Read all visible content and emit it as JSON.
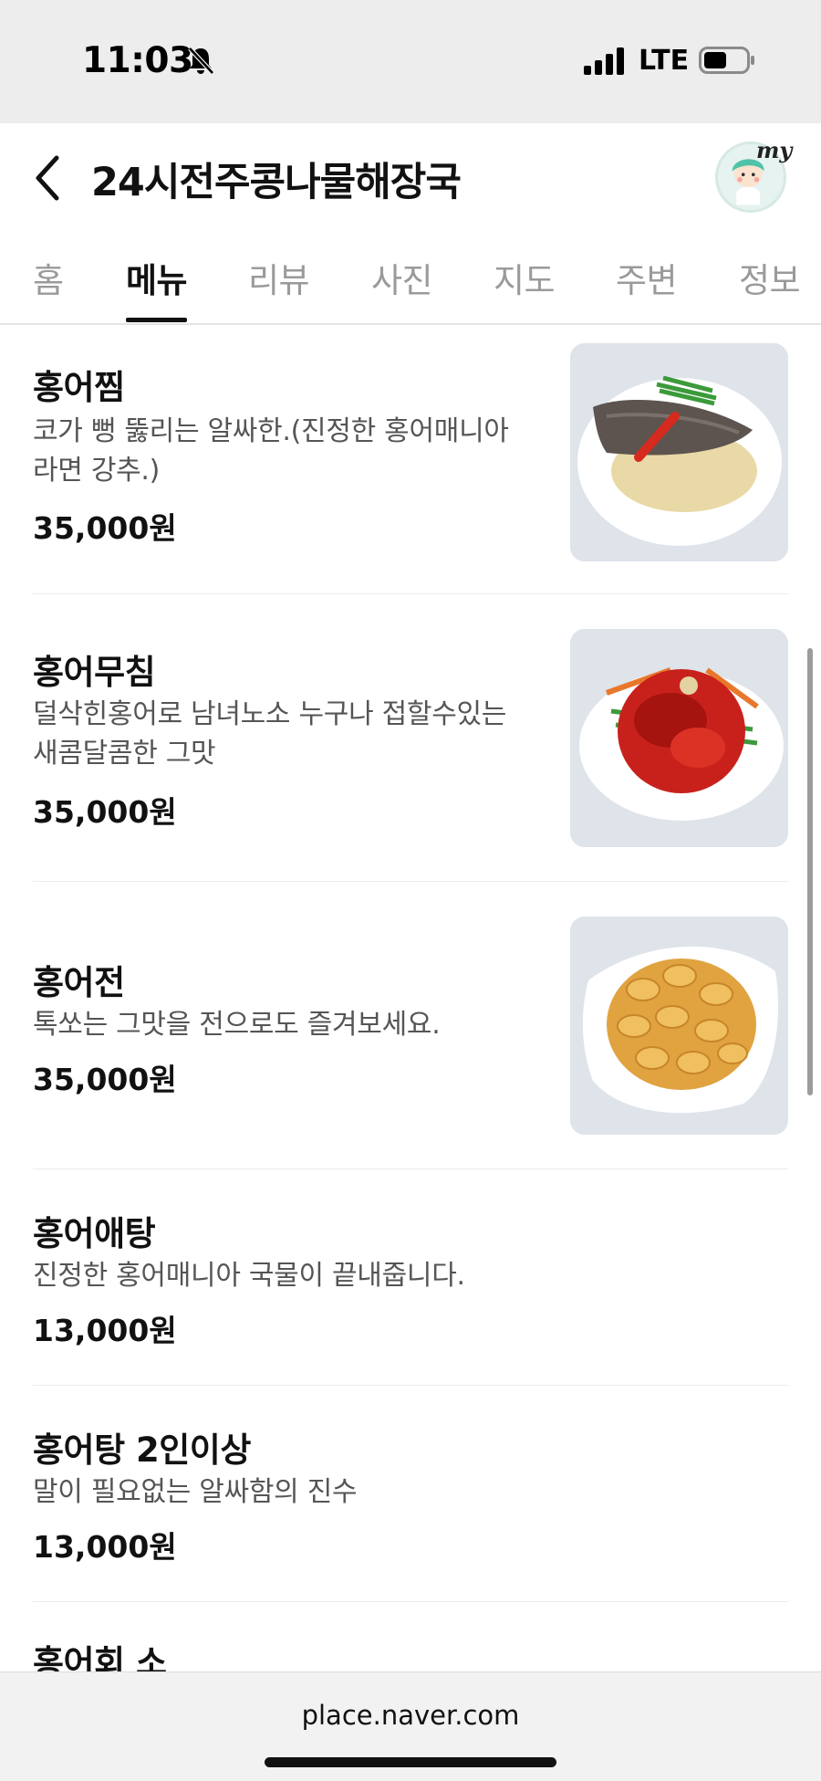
{
  "status_bar": {
    "time": "11:03",
    "network": "LTE",
    "icons": [
      "bell-slash-icon",
      "signal-icon",
      "battery-icon"
    ]
  },
  "header": {
    "title": "24시전주콩나물해장국",
    "avatar_badge": "my",
    "icons": [
      "back-icon",
      "avatar"
    ]
  },
  "tabs": [
    {
      "label": "홈"
    },
    {
      "label": "메뉴",
      "active": true
    },
    {
      "label": "리뷰"
    },
    {
      "label": "사진"
    },
    {
      "label": "지도"
    },
    {
      "label": "주변"
    },
    {
      "label": "정보"
    }
  ],
  "menu": [
    {
      "name": "홍어찜",
      "desc_line1": "코가 뻥 뚫리는 알싸한.(진정한 홍어매니아",
      "desc_line2": "라면 강추.)",
      "price": "35,000원",
      "image": "steamed-skate-photo"
    },
    {
      "name": "홍어무침",
      "desc_line1": "덜삭힌홍어로 남녀노소 누구나 접할수있는",
      "desc_line2": "새콤달콤한 그맛",
      "price": "35,000원",
      "image": "spicy-skate-salad-photo"
    },
    {
      "name": "홍어전",
      "desc_line1": "톡쏘는 그맛을 전으로도 즐겨보세요.",
      "price": "35,000원",
      "image": "skate-pancake-photo"
    },
    {
      "name": "홍어애탕",
      "desc_line1": "진정한 홍어매니아 국물이 끝내줍니다.",
      "price": "13,000원"
    },
    {
      "name": "홍어탕 2인이상",
      "desc_line1": "말이 필요없는 알싸함의 진수",
      "price": "13,000원"
    },
    {
      "name": "홍어회 소"
    }
  ],
  "bottom_bar": {
    "url": "place.naver.com"
  },
  "colors": {
    "status_bg": "#ededed",
    "text_primary": "#111111",
    "text_secondary": "#555555",
    "tab_inactive": "#9a9a9a"
  }
}
